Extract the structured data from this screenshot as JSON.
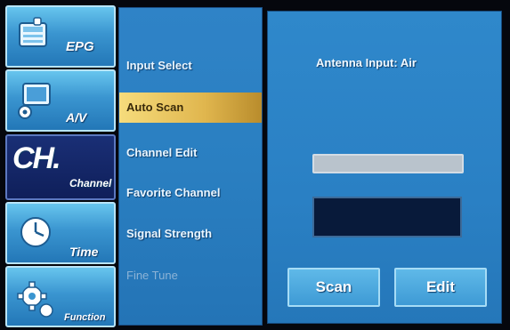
{
  "nav": {
    "tiles": [
      {
        "label": "EPG",
        "icon": "epg-icon",
        "active": false
      },
      {
        "label": "A/V",
        "icon": "av-icon",
        "active": false
      },
      {
        "big": "CH.",
        "label": "Channel",
        "icon": "channel-icon",
        "active": true
      },
      {
        "label": "Time",
        "icon": "clock-icon",
        "active": false
      },
      {
        "label": "Function",
        "icon": "gear-icon",
        "active": false
      }
    ]
  },
  "menu": {
    "items": [
      {
        "label": "Input Select",
        "state": "normal"
      },
      {
        "label": "Auto Scan",
        "state": "selected"
      },
      {
        "label": "Channel Edit",
        "state": "normal"
      },
      {
        "label": "Favorite Channel",
        "state": "normal"
      },
      {
        "label": "Signal Strength",
        "state": "normal"
      },
      {
        "label": "Fine Tune",
        "state": "disabled"
      }
    ]
  },
  "panel": {
    "antenna_text": "Antenna Input: Air",
    "scan_progress": 0,
    "channel_display": "",
    "scan_label": "Scan",
    "edit_label": "Edit"
  },
  "colors": {
    "accent_blue": "#2f83c7",
    "selected_gold": "#e0b64e",
    "active_tile": "#0f1f5a"
  }
}
